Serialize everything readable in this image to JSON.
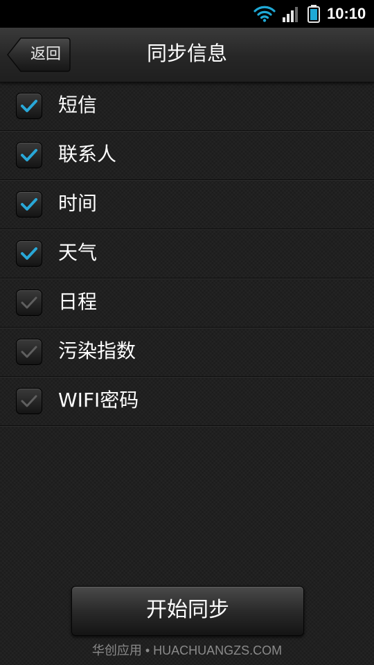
{
  "status_bar": {
    "time": "10:10",
    "icons": [
      "wifi-icon",
      "signal-icon",
      "battery-icon"
    ],
    "wifi_color": "#1fa9d6",
    "battery_color": "#1fa9d6"
  },
  "header": {
    "back_label": "返回",
    "title": "同步信息"
  },
  "sync_items": [
    {
      "label": "短信",
      "checked": true
    },
    {
      "label": "联系人",
      "checked": true
    },
    {
      "label": "时间",
      "checked": true
    },
    {
      "label": "天气",
      "checked": true
    },
    {
      "label": "日程",
      "checked": false
    },
    {
      "label": "污染指数",
      "checked": false
    },
    {
      "label": "WIFI密码",
      "checked": false
    }
  ],
  "actions": {
    "start_sync_label": "开始同步"
  },
  "footer": {
    "watermark": "华创应用 • HUACHUANGZS.COM"
  },
  "colors": {
    "check_active": "#29a8d8",
    "check_inactive": "#5f5f5f"
  }
}
